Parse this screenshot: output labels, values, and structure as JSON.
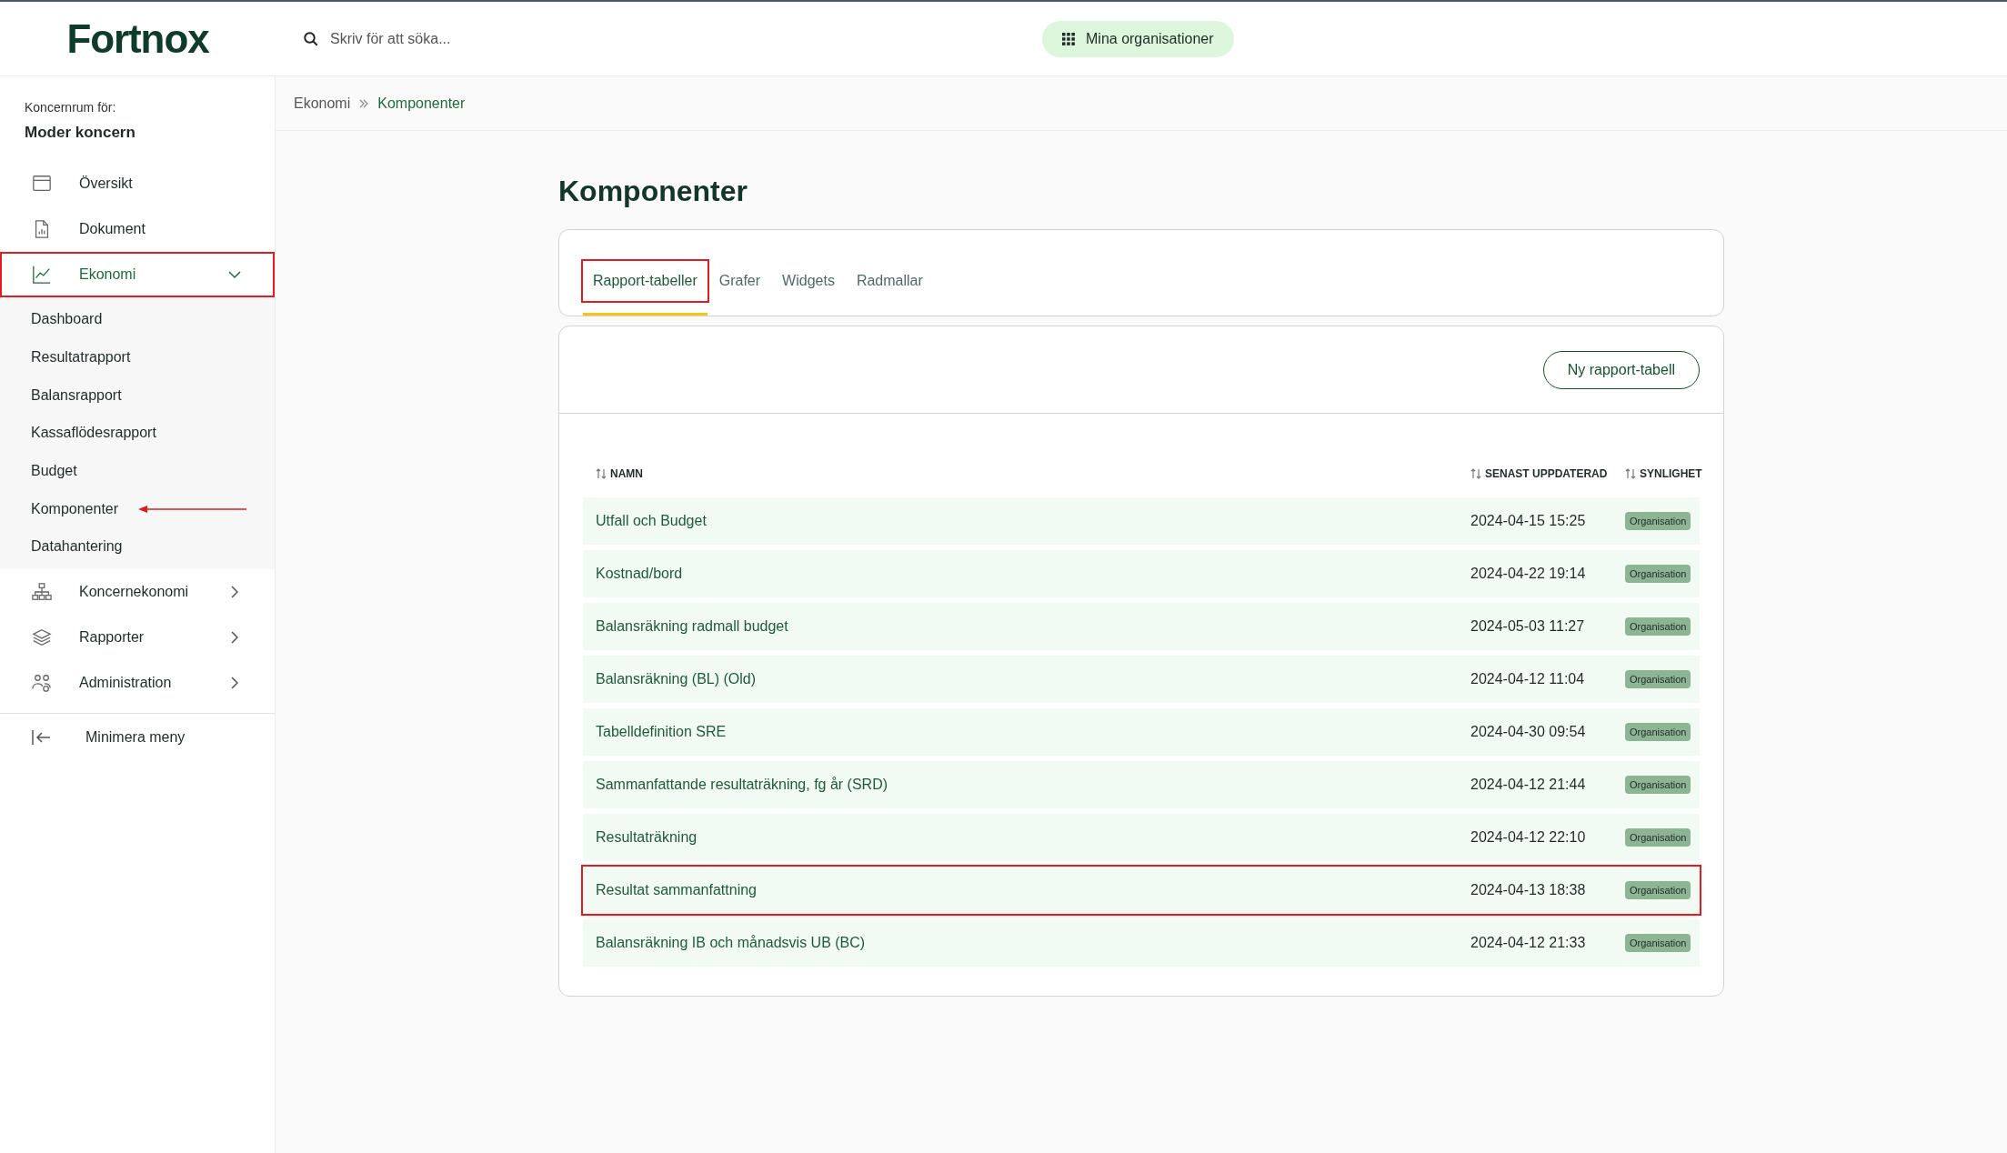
{
  "header": {
    "logo": "Fortnox",
    "search": {
      "placeholder": "Skriv för att söka..."
    },
    "org_button": "Mina organisationer"
  },
  "sidebar": {
    "context_label": "Koncernrum för:",
    "context_name": "Moder koncern",
    "items": [
      {
        "label": "Översikt",
        "selected": false,
        "highlighted": false
      },
      {
        "label": "Dokument",
        "selected": false,
        "highlighted": false
      },
      {
        "label": "Ekonomi",
        "expanded": true,
        "selected": true,
        "highlighted": true,
        "children": [
          {
            "label": "Dashboard",
            "selected": false,
            "pointer_arrow": false
          },
          {
            "label": "Resultatrapport",
            "selected": false,
            "pointer_arrow": false
          },
          {
            "label": "Balansrapport",
            "selected": false,
            "pointer_arrow": false
          },
          {
            "label": "Kassaflödesrapport",
            "selected": false,
            "pointer_arrow": false
          },
          {
            "label": "Budget",
            "selected": false,
            "pointer_arrow": false
          },
          {
            "label": "Komponenter",
            "selected": false,
            "pointer_arrow": true
          },
          {
            "label": "Datahantering",
            "selected": false,
            "pointer_arrow": false
          }
        ]
      },
      {
        "label": "Koncernekonomi",
        "expanded": false,
        "selected": false,
        "highlighted": false
      },
      {
        "label": "Rapporter",
        "expanded": false,
        "selected": false,
        "highlighted": false
      },
      {
        "label": "Administration",
        "expanded": false,
        "selected": false,
        "highlighted": false
      }
    ],
    "collapse": "Minimera meny"
  },
  "breadcrumb": [
    "Ekonomi",
    "Komponenter"
  ],
  "page_title": "Komponenter",
  "tabs": [
    {
      "label": "Rapport-tabeller",
      "selected": true,
      "highlighted": true
    },
    {
      "label": "Grafer",
      "selected": false,
      "highlighted": false
    },
    {
      "label": "Widgets",
      "selected": false,
      "highlighted": false
    },
    {
      "label": "Radmallar",
      "selected": false,
      "highlighted": false
    }
  ],
  "new_button": "Ny rapport-tabell",
  "table": {
    "columns": [
      "NAMN",
      "SENAST UPPDATERAD",
      "SYNLIGHET"
    ],
    "rows": [
      {
        "name": "Utfall och Budget",
        "updated": "2024-04-15 15:25",
        "visibility": "Organisation",
        "highlighted": false
      },
      {
        "name": "Kostnad/bord",
        "updated": "2024-04-22 19:14",
        "visibility": "Organisation",
        "highlighted": false
      },
      {
        "name": "Balansräkning radmall budget",
        "updated": "2024-05-03 11:27",
        "visibility": "Organisation",
        "highlighted": false
      },
      {
        "name": "Balansräkning (BL) (Old)",
        "updated": "2024-04-12 11:04",
        "visibility": "Organisation",
        "highlighted": false
      },
      {
        "name": "Tabelldefinition SRE",
        "updated": "2024-04-30 09:54",
        "visibility": "Organisation",
        "highlighted": false
      },
      {
        "name": "Sammanfattande resultaträkning, fg år (SRD)",
        "updated": "2024-04-12 21:44",
        "visibility": "Organisation",
        "highlighted": false
      },
      {
        "name": "Resultaträkning",
        "updated": "2024-04-12 22:10",
        "visibility": "Organisation",
        "highlighted": false
      },
      {
        "name": "Resultat sammanfattning",
        "updated": "2024-04-13 18:38",
        "visibility": "Organisation",
        "highlighted": true
      },
      {
        "name": "Balansräkning IB och månadsvis UB (BC)",
        "updated": "2024-04-12 21:33",
        "visibility": "Organisation",
        "highlighted": false
      }
    ]
  }
}
